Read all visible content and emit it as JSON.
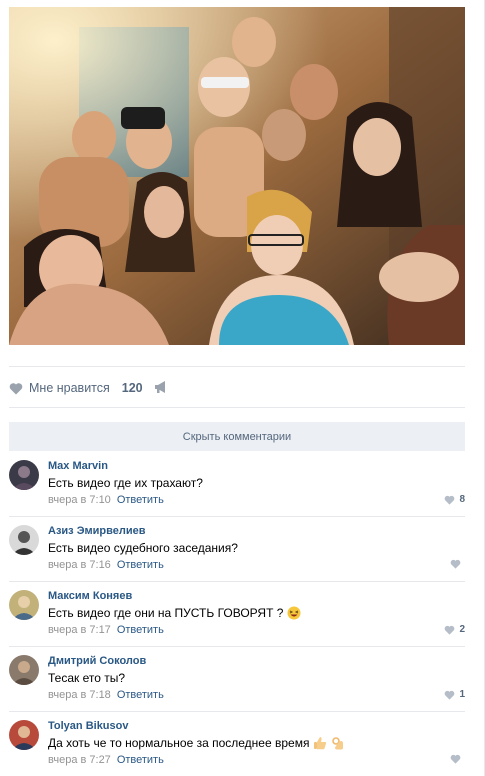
{
  "post": {
    "photo_icon": "group-selfie-photo",
    "likes": {
      "label": "Мне нравится",
      "count": "120"
    },
    "share_icon": "megaphone-icon"
  },
  "hide_comments_label": "Скрыть комментарии",
  "comments": [
    {
      "author": "Max Marvin",
      "text": "Есть видео где их трахают?",
      "time": "вчера в 7:10",
      "reply": "Ответить",
      "likes": "8",
      "avatar_color": "#3a3a48",
      "emoji": ""
    },
    {
      "author": "Азиз Эмирвелиев",
      "text": "Есть видео судебного заседания?",
      "time": "вчера в 7:16",
      "reply": "Ответить",
      "likes": "",
      "avatar_color": "#6d6d6d",
      "emoji": ""
    },
    {
      "author": "Максим Коняев",
      "text": "Есть видео где они на ПУСТЬ ГОВОРЯТ ?",
      "time": "вчера в 7:17",
      "reply": "Ответить",
      "likes": "2",
      "avatar_color": "#c2b27a",
      "emoji": "laughing-emoji"
    },
    {
      "author": "Дмитрий Соколов",
      "text": "Тесак ето ты?",
      "time": "вчера в 7:18",
      "reply": "Ответить",
      "likes": "1",
      "avatar_color": "#8a7a6c",
      "emoji": ""
    },
    {
      "author": "Tolyan Bikusov",
      "text": "Да хоть че то нормальное за последнее время",
      "time": "вчера в 7:27",
      "reply": "Ответить",
      "likes": "",
      "avatar_color": "#b84a3c",
      "emoji": "thumbs-up-ok-emoji"
    }
  ],
  "colors": {
    "link": "#2a5885",
    "meta": "#939393",
    "icon": "#99a2ad",
    "hide_bg": "#eceff3"
  }
}
